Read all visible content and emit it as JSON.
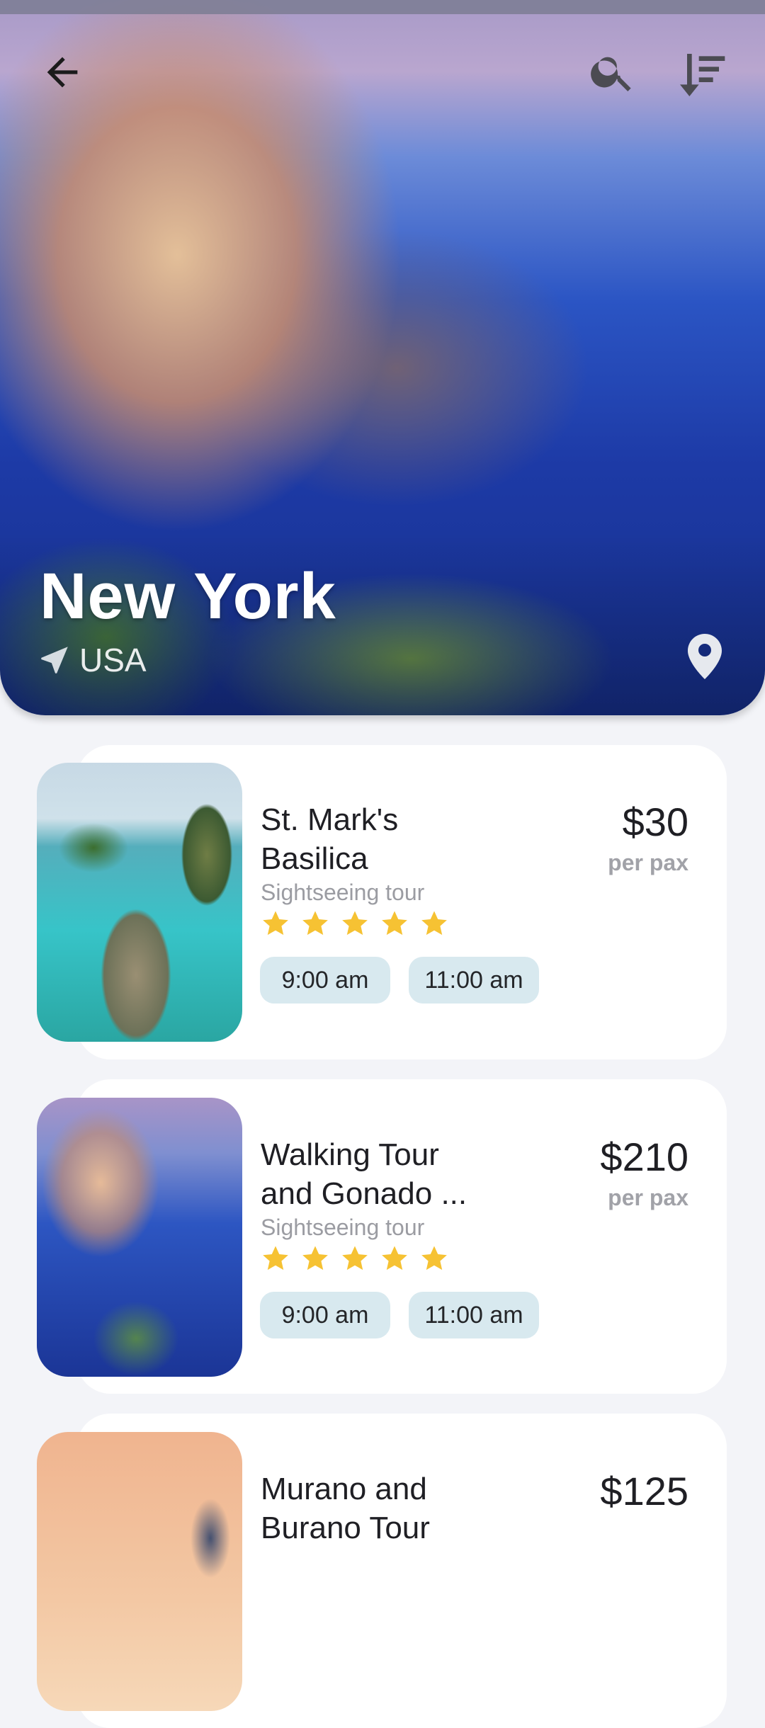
{
  "hero": {
    "city": "New York",
    "country": "USA",
    "icons": [
      "arrow-left-icon",
      "search-icon",
      "sort-icon",
      "navigation-icon",
      "location-pin-icon"
    ]
  },
  "tours": [
    {
      "title_line1": "St. Mark's",
      "title_line2": "Basilica",
      "category": "Sightseeing tour",
      "rating": 5,
      "times": [
        "9:00 am",
        "11:00 am"
      ],
      "price": "$30",
      "price_unit": "per pax"
    },
    {
      "title_line1": "Walking Tour",
      "title_line2": "and Gonado ...",
      "category": "Sightseeing tour",
      "rating": 5,
      "times": [
        "9:00 am",
        "11:00 am"
      ],
      "price": "$210",
      "price_unit": "per pax"
    },
    {
      "title_line1": "Murano and",
      "title_line2": "Burano Tour",
      "price": "$125"
    }
  ],
  "colors": {
    "page_bg": "#f3f4f8",
    "chip_bg": "#d8e9ef",
    "star": "#f6c233"
  }
}
